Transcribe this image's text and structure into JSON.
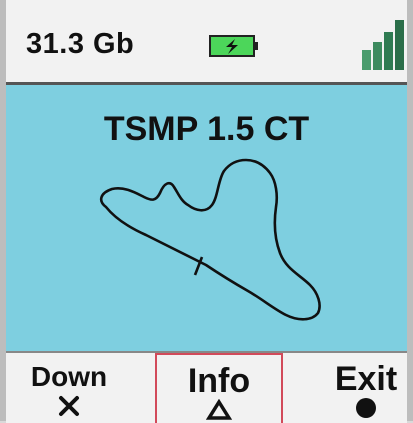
{
  "status_bar": {
    "storage": "31.3 Gb",
    "battery_icon": "battery-charging-icon",
    "signal_icon": "signal-strength-icon"
  },
  "display": {
    "title": "TSMP 1.5 CT",
    "track_icon": "track-map-icon"
  },
  "softkeys": {
    "left": {
      "label": "Down",
      "icon": "cross-icon"
    },
    "center": {
      "label": "Info",
      "icon": "triangle-icon"
    },
    "right": {
      "label": "Exit",
      "icon": "circle-icon"
    }
  },
  "colors": {
    "display_bg": "#7ecfe0",
    "battery_fill": "#4cd65a",
    "signal": "#2e7d4f",
    "highlight_border": "#d24a5a"
  }
}
